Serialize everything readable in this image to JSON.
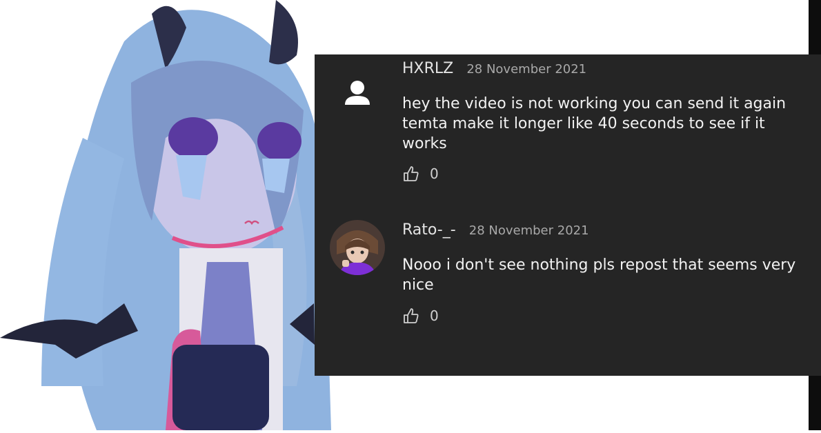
{
  "comments": [
    {
      "author": "HXRLZ",
      "date": "28 November 2021",
      "text": "hey the video is not working you can send it again temta make it longer like 40 seconds to see if it works",
      "likes": "0",
      "avatar": "default-user-icon"
    },
    {
      "author": "Rato-_-",
      "date": "28 November 2021",
      "text": "Nooo i don't see nothing pls repost that seems very nice",
      "likes": "0",
      "avatar": "profile-picture"
    }
  ],
  "colors": {
    "panel": "#252525",
    "text": "#f2f2f2",
    "date": "#a9a9a9"
  }
}
